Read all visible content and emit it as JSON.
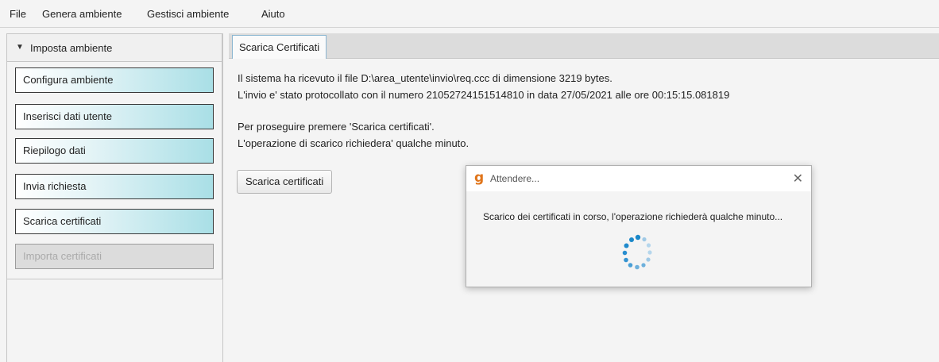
{
  "menu": {
    "items": [
      "File",
      "Genera ambiente",
      "Gestisci ambiente",
      "Aiuto"
    ]
  },
  "sidebar": {
    "title": "Imposta ambiente",
    "buttons": [
      {
        "label": "Configura ambiente",
        "enabled": true
      },
      {
        "label": "Inserisci dati utente",
        "enabled": true
      },
      {
        "label": "Riepilogo dati",
        "enabled": true
      },
      {
        "label": "Invia richiesta",
        "enabled": true
      },
      {
        "label": "Scarica certificati",
        "enabled": true
      },
      {
        "label": "Importa certificati",
        "enabled": false
      }
    ]
  },
  "tab": {
    "label": "Scarica Certificati"
  },
  "content": {
    "line1": "Il sistema ha ricevuto il file D:\\area_utente\\invio\\req.ccc di dimensione 3219 bytes.",
    "line2": "L'invio e' stato protocollato con il numero 21052724151514810 in data 27/05/2021 alle ore 00:15:15.081819",
    "line3": "Per proseguire premere 'Scarica certificati'.",
    "line4": "L'operazione di scarico richiedera' qualche minuto.",
    "button_label": "Scarica certificati"
  },
  "dialog": {
    "title": "Attendere...",
    "icon": "app-logo-icon",
    "close_icon": "close-icon",
    "message": "Scarico dei certificati in corso, l'operazione richiederà qualche minuto...",
    "spinner_icon": "loading-spinner-icon"
  },
  "colors": {
    "accent": "#a9dfe6",
    "spinner": "#1a88c9",
    "tab_border": "#8bb6d1"
  }
}
